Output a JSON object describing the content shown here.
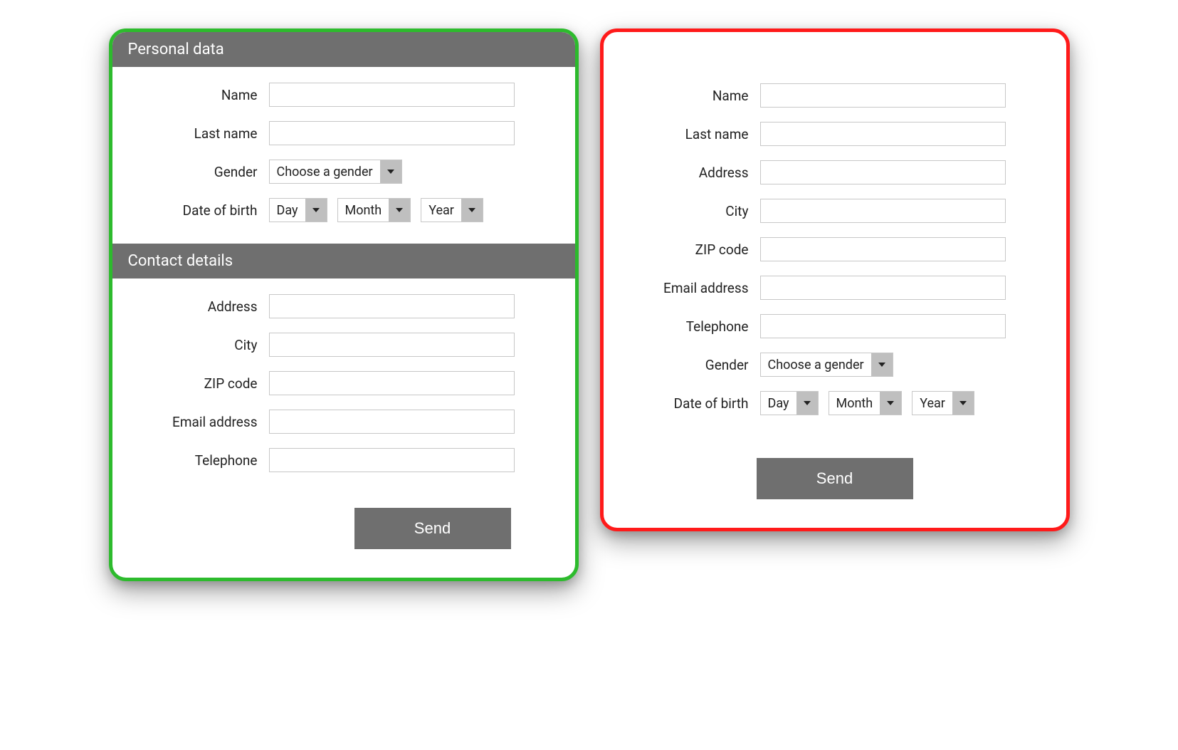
{
  "good_form": {
    "sections": {
      "personal": {
        "title": "Personal data",
        "fields": {
          "name_label": "Name",
          "lastname_label": "Last name",
          "gender_label": "Gender",
          "gender_value": "Choose a gender",
          "dob_label": "Date of birth",
          "dob_day": "Day",
          "dob_month": "Month",
          "dob_year": "Year"
        }
      },
      "contact": {
        "title": "Contact details",
        "fields": {
          "address_label": "Address",
          "city_label": "City",
          "zip_label": "ZIP code",
          "email_label": "Email address",
          "telephone_label": "Telephone"
        }
      }
    },
    "send_button": "Send"
  },
  "bad_form": {
    "fields": {
      "name_label": "Name",
      "lastname_label": "Last name",
      "address_label": "Address",
      "city_label": "City",
      "zip_label": "ZIP code",
      "email_label": "Email address",
      "telephone_label": "Telephone",
      "gender_label": "Gender",
      "gender_value": "Choose a gender",
      "dob_label": "Date of birth",
      "dob_day": "Day",
      "dob_month": "Month",
      "dob_year": "Year"
    },
    "send_button": "Send"
  }
}
